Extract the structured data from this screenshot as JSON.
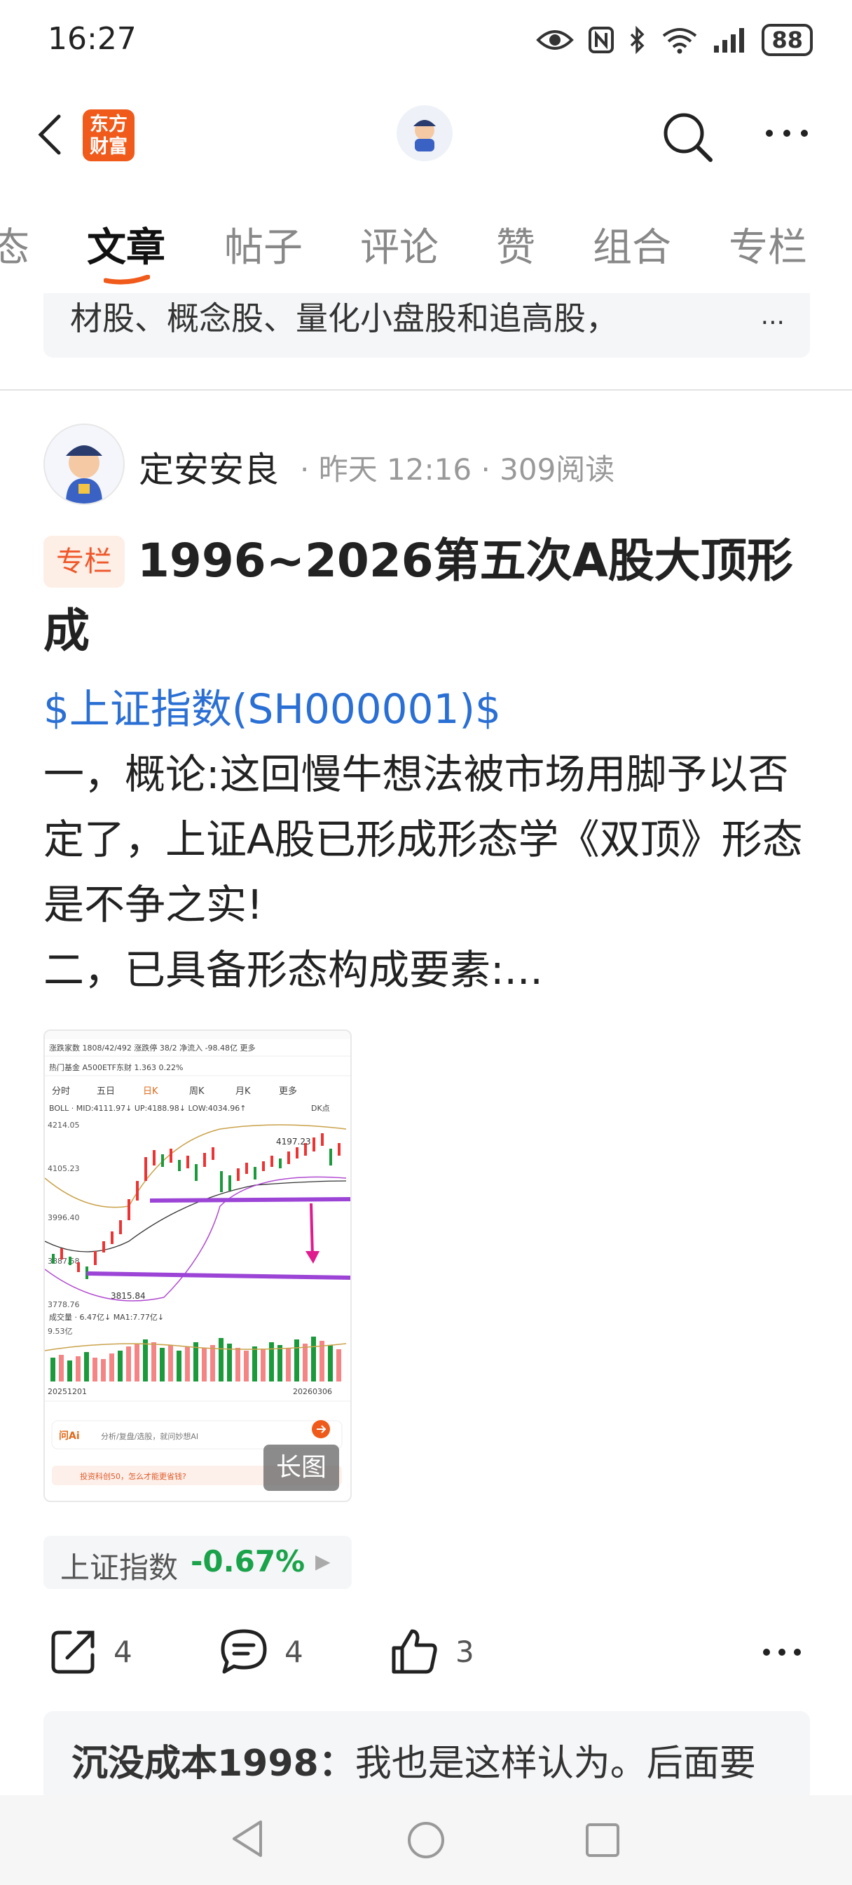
{
  "status_bar": {
    "time": "16:27",
    "battery": "88"
  },
  "header": {
    "logo_text_line1": "东方",
    "logo_text_line2": "财富"
  },
  "tabs": [
    {
      "label": "态"
    },
    {
      "label": "文章"
    },
    {
      "label": "帖子"
    },
    {
      "label": "评论"
    },
    {
      "label": "赞"
    },
    {
      "label": "组合"
    },
    {
      "label": "专栏"
    }
  ],
  "snippet": {
    "text": "材股、概念股、量化小盘股和追高股，",
    "ellipsis": "..."
  },
  "post": {
    "author": "定安安良",
    "meta": "· 昨天 12:16 · 309阅读",
    "badge": "专栏",
    "title": "1996~2026第五次A股大顶形成",
    "stock_link": "$上证指数(SH000001)$",
    "body_line1": "一，概论:这回慢牛想法被市场用脚予以否定了，上证A股已形成形态学《双顶》形态是不争之实!",
    "body_line2": "二，已具备形态构成要素:...",
    "image_tag": "长图"
  },
  "chart_image": {
    "row1": "涨跌家数 1808/42/492  涨跌停 38/2  净流入 -98.48亿  更多",
    "row2": "热门基金  A500ETF东财 1.363 0.22%",
    "tabs": [
      "分时",
      "五日",
      "日K",
      "周K",
      "月K",
      "更多"
    ],
    "boll": "BOLL · MID:4111.97↓ UP:4188.98↓ LOW:4034.96↑",
    "dk": "DK点",
    "y_labels": [
      "4214.05",
      "4105.23",
      "3996.40",
      "3887.58",
      "3778.76"
    ],
    "high_label": "4197.23",
    "low_label": "3815.84",
    "volume_label": "成交量 · 6.47亿↓ MA1:7.77亿↓",
    "vol_y": "9.53亿",
    "date_start": "20251201",
    "date_end": "20260306",
    "ai_label": "问Ai",
    "ai_placeholder": "分析/复盘/选股，就问妙想AI",
    "promo": "投资科创50，怎么才能更省钱?"
  },
  "stock_chip": {
    "name": "上证指数",
    "change": "-0.67%"
  },
  "actions": {
    "share_count": "4",
    "comment_count": "4",
    "like_count": "3"
  },
  "comment": {
    "author": "沉没成本1998：",
    "text": "我也是这样认为。后面要"
  },
  "colors": {
    "brand": "#f05a1a",
    "link": "#2a6fd4",
    "down": "#1aa34a",
    "badge_bg": "#fdeee6"
  }
}
